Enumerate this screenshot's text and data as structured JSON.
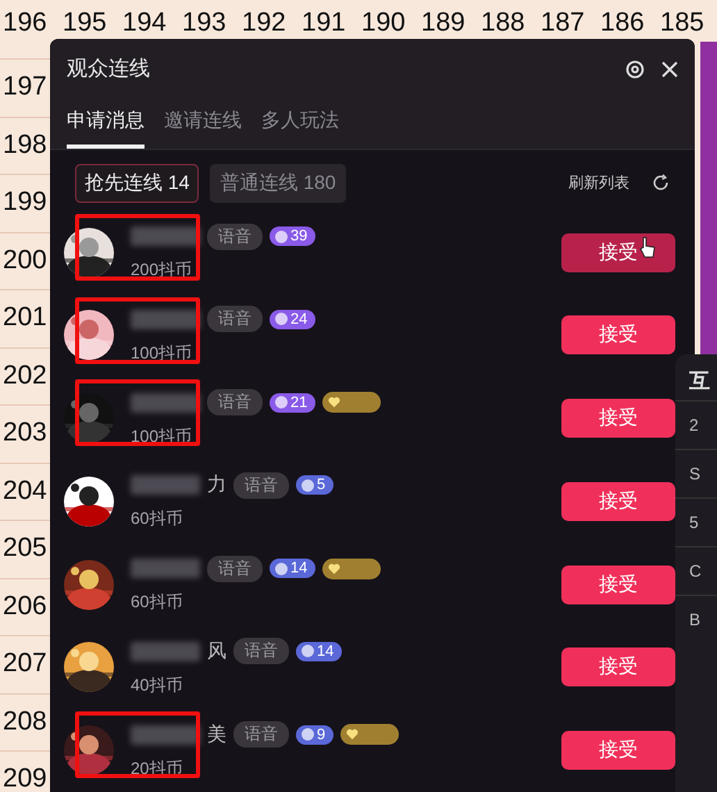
{
  "sheet": {
    "top_numbers": [
      "196",
      "195",
      "194",
      "193",
      "192",
      "191",
      "190",
      "189",
      "188",
      "187",
      "186",
      "185"
    ],
    "left_numbers": [
      "197",
      "198",
      "199",
      "200",
      "201",
      "202",
      "203",
      "204",
      "205",
      "206",
      "207",
      "208",
      "209"
    ]
  },
  "panel": {
    "title": "观众连线",
    "tabs": [
      {
        "label": "申请消息",
        "selected": true
      },
      {
        "label": "邀请连线",
        "selected": false
      },
      {
        "label": "多人玩法",
        "selected": false
      }
    ],
    "segments": [
      {
        "label": "抢先连线 14",
        "selected": true
      },
      {
        "label": "普通连线 180",
        "selected": false
      }
    ],
    "refresh": "刷新列表",
    "requests": [
      {
        "tag": "语音",
        "rank": "39",
        "color": "#8a5ae8",
        "fan_badge": false,
        "coins": "200抖币",
        "button": "接受",
        "hover": true,
        "highlighted": true
      },
      {
        "tag": "语音",
        "rank": "24",
        "color": "#8a5ae8",
        "fan_badge": false,
        "coins": "100抖币",
        "button": "接受",
        "hover": false,
        "highlighted": true
      },
      {
        "tag": "语音",
        "rank": "21",
        "color": "#8a5ae8",
        "fan_badge": true,
        "coins": "100抖币",
        "button": "接受",
        "hover": false,
        "highlighted": true
      },
      {
        "name": "力",
        "tag": "语音",
        "rank": "5",
        "color": "#5a68d8",
        "fan_badge": false,
        "coins": "60抖币",
        "button": "接受",
        "hover": false,
        "highlighted": false
      },
      {
        "tag": "语音",
        "rank": "14",
        "color": "#5a68d8",
        "fan_badge": true,
        "coins": "60抖币",
        "button": "接受",
        "hover": false,
        "highlighted": false
      },
      {
        "name": "风",
        "tag": "语音",
        "rank": "14",
        "color": "#5a68d8",
        "fan_badge": false,
        "coins": "40抖币",
        "button": "接受",
        "hover": false,
        "highlighted": false
      },
      {
        "name": "美",
        "tag": "语音",
        "rank": "9",
        "color": "#5a68d8",
        "fan_badge": true,
        "coins": "20抖币",
        "button": "接受",
        "hover": false,
        "highlighted": true
      }
    ]
  },
  "side_panel": {
    "title": "互",
    "items": [
      "2",
      "S",
      "5",
      "C",
      "B"
    ]
  }
}
